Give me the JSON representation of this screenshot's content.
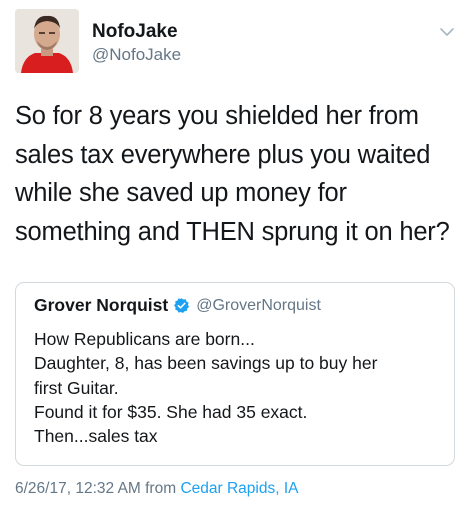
{
  "author": {
    "display_name": "NofoJake",
    "handle": "@NofoJake"
  },
  "tweet_lines": [
    "So for 8 years you shielded her from",
    "sales tax everywhere plus you waited",
    "while she saved up money for",
    "something and THEN sprung it on her?"
  ],
  "quoted_tweet": {
    "display_name": "Grover Norquist",
    "handle": "@GroverNorquist",
    "lines": [
      "How Republicans are born...",
      "Daughter, 8, has been savings up to buy her",
      "first Guitar.",
      "Found it for $35.  She had 35 exact.",
      "Then...sales tax"
    ]
  },
  "meta": {
    "timestamp": "6/26/17, 12:32 AM from",
    "location": "Cedar Rapids, IA"
  },
  "colors": {
    "link_blue": "#1da1f2",
    "secondary_gray": "#657786",
    "text": "#14171a"
  },
  "icons": {
    "caret": "chevron-down-icon",
    "verified": "verified-badge-icon"
  }
}
